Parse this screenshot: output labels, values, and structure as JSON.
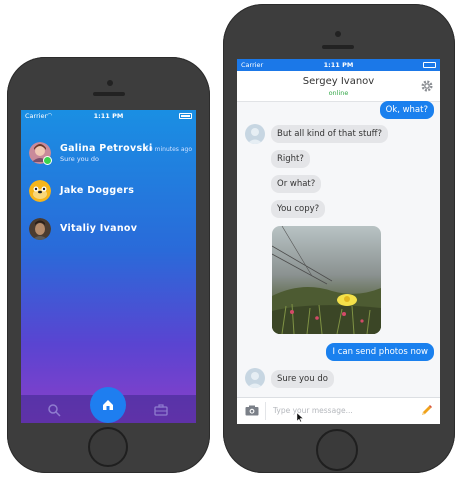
{
  "left_phone": {
    "status": {
      "carrier": "Carrier",
      "time": "1:11 PM"
    },
    "contacts": [
      {
        "name": "Galina Petrovski",
        "message": "Sure you do",
        "time": "10 minutes ago",
        "online": true
      },
      {
        "name": "Jake Doggers",
        "message": "",
        "time": ""
      },
      {
        "name": "Vitaliy Ivanov",
        "message": "",
        "time": ""
      }
    ],
    "tabs": [
      "search-icon",
      "home-icon",
      "briefcase-icon"
    ]
  },
  "right_phone": {
    "status": {
      "carrier": "Carrier",
      "time": "1:11 PM"
    },
    "header": {
      "title": "Sergey Ivanov",
      "subtitle": "online"
    },
    "messages": [
      {
        "text": "Ok, what?",
        "direction": "out"
      },
      {
        "text": "But all kind of that stuff?",
        "direction": "in"
      },
      {
        "text": "Right?",
        "direction": "in"
      },
      {
        "text": "Or what?",
        "direction": "in"
      },
      {
        "text": "You copy?",
        "direction": "in"
      },
      {
        "text": "I can send photos now",
        "direction": "out"
      },
      {
        "text": "Sure you do",
        "direction": "in"
      }
    ],
    "input": {
      "placeholder": "Type your message..."
    }
  },
  "colors": {
    "accent": "#1a80ee",
    "online": "#36a94a",
    "phone": "#3d3d3d"
  }
}
